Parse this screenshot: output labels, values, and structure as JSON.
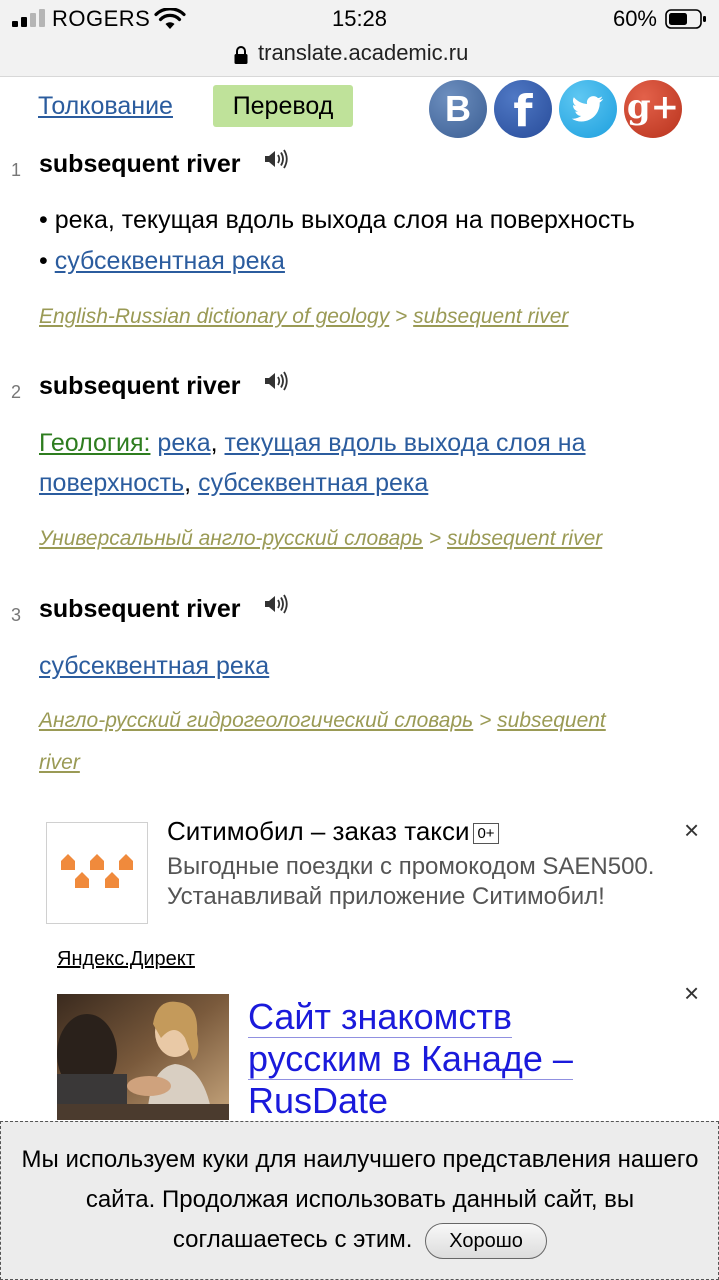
{
  "status_bar": {
    "carrier": "ROGERS",
    "time": "15:28",
    "battery": "60%"
  },
  "browser": {
    "url": "translate.academic.ru"
  },
  "nav": {
    "tab_link": "Толкование",
    "tab_active": "Перевод"
  },
  "social": {
    "vk": "В",
    "fb": "f",
    "gp": "g+"
  },
  "entries": [
    {
      "num": "1",
      "title": "subsequent river",
      "bullet1": "• река, текущая вдоль выхода слоя на поверхность",
      "bullet2_mark": "•",
      "bullet2_link": "субсеквентная река",
      "source": "English-Russian dictionary of geology",
      "source_sep": ">",
      "source_term": "subsequent river"
    },
    {
      "num": "2",
      "title": "subsequent river",
      "domain": "Геология:",
      "w1": "река",
      "w2": "текущая вдоль выхода слоя на",
      "w3": "поверхность",
      "w4": "субсеквентная река",
      "comma": ",",
      "source": "Универсальный англо-русский словарь",
      "source_sep": ">",
      "source_term": "subsequent river"
    },
    {
      "num": "3",
      "title": "subsequent river",
      "link": "субсеквентная река",
      "source": "Англо-русский гидрогеологический словарь",
      "source_sep": ">",
      "source_term_a": "subsequent",
      "source_term_b": "river"
    }
  ],
  "ad1": {
    "title": "Ситимобил – заказ такси",
    "age": "0+",
    "description": "Выгодные поездки с промокодом SAEN500. Устанавливай приложение Ситимобил!",
    "close": "×",
    "source": "Яндекс.Директ"
  },
  "ad2": {
    "title_line1": "Сайт знакомств",
    "title_line2": "русским в Канаде –",
    "title_line3": "RusDate",
    "close": "×"
  },
  "cookie": {
    "text": "Мы используем куки для наилучшего представления нашего сайта. Продолжая использовать данный сайт, вы соглашаетесь с этим.",
    "button": "Хорошо"
  }
}
